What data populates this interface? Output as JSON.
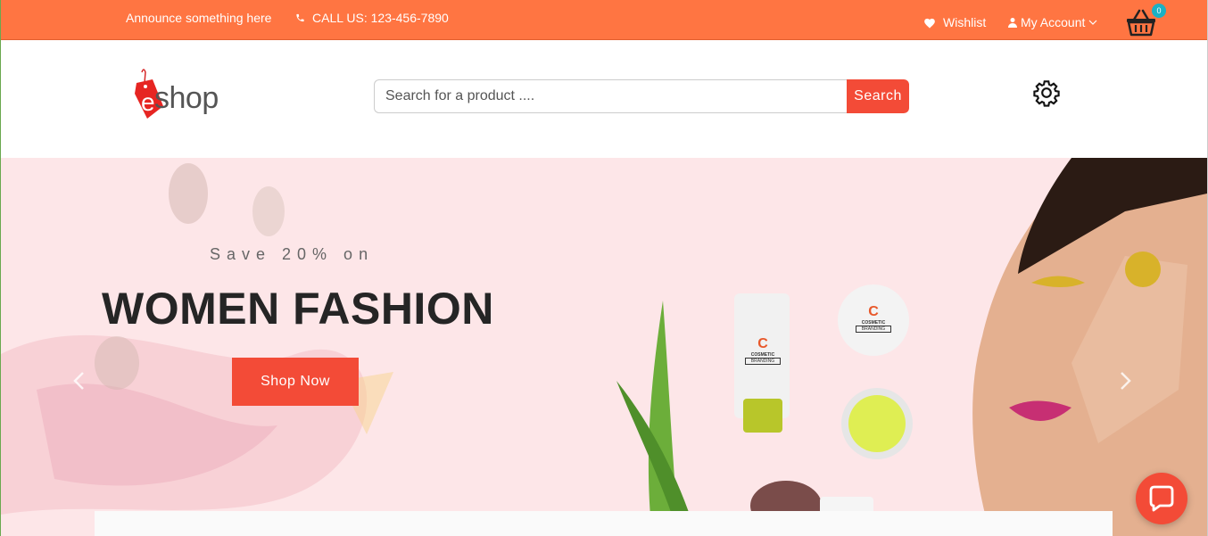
{
  "topbar": {
    "announce": "Announce something here",
    "call": "CALL US: 123-456-7890",
    "wishlist": "Wishlist",
    "account": "My Account",
    "cart_count": "0"
  },
  "header": {
    "logo_text": "shop",
    "logo_letter": "e",
    "search_placeholder": "Search for a product ....",
    "search_button": "Search"
  },
  "hero": {
    "pretitle": "Save 20% on",
    "title": "WOMEN FASHION",
    "cta": "Shop Now",
    "product_brand": "COSMETIC",
    "product_sub": "BRANDING",
    "product_letter": "C"
  },
  "colors": {
    "topbar": "#ff7542",
    "accent": "#f34b37",
    "hero_bg": "#fde6e8",
    "badge": "#1bb1c4"
  },
  "icons": [
    "phone-icon",
    "heart-icon",
    "user-icon",
    "chevron-down-icon",
    "basket-icon",
    "gear-icon",
    "chevron-left-icon",
    "chevron-right-icon",
    "chat-icon"
  ]
}
